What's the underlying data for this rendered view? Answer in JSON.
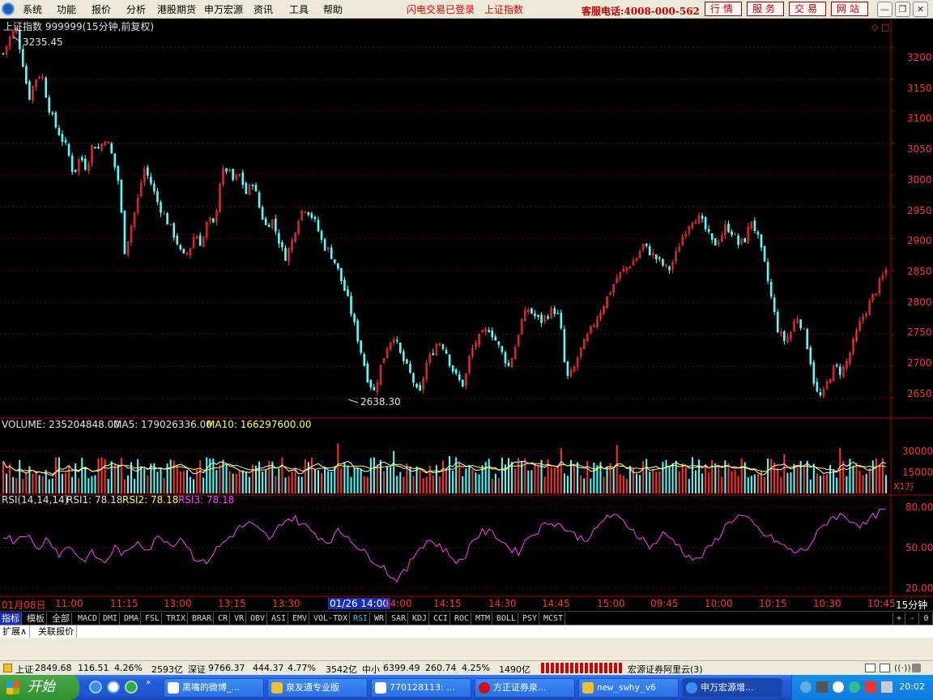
{
  "menu": {
    "items": [
      "系统",
      "功能",
      "报价",
      "分析",
      "港股期货",
      "申万宏源",
      "资讯",
      "工具",
      "帮助"
    ],
    "flash_login": "闪电交易已登录",
    "index_name": "上证指数",
    "service_phone": "客服电话:4008-000-562",
    "tabs": [
      "行情",
      "服务",
      "交易",
      "网站"
    ]
  },
  "chart_header": {
    "title": "上证指数 999999(15分钟,前复权)",
    "high_label": "3235.45",
    "low_label": "2638.30"
  },
  "price_axis": [
    "3200",
    "3150",
    "3100",
    "3050",
    "3000",
    "2950",
    "2900",
    "2850",
    "2800",
    "2750",
    "2700",
    "2650"
  ],
  "volume": {
    "label": "VOLUME: 235204848.00",
    "ma5": "MA5: 179026336.00",
    "ma10": "MA10: 166297600.00",
    "ticks": [
      "30000",
      "15000"
    ],
    "unit": "X1万"
  },
  "rsi": {
    "label": "RSI(14,14,14)",
    "rsi1": "RSI1: 78.18",
    "rsi2": "RSI2: 78.18",
    "rsi3": "RSI3: 78.18",
    "ticks": [
      "80.00",
      "50.00",
      "20.00"
    ]
  },
  "time_axis": [
    "01月08日",
    "11:00",
    "11:15",
    "13:00",
    "13:15",
    "13:30",
    "01/26 14:00",
    "14:00",
    "14:15",
    "14:30",
    "14:45",
    "15:00",
    "09:45",
    "10:00",
    "10:15",
    "10:30",
    "10:45",
    "15分钟"
  ],
  "indicator_tabs": [
    "指标",
    "模板",
    "全部",
    "MACD",
    "DMI",
    "DMA",
    "FSL",
    "TRIX",
    "BRAR",
    "CR",
    "VR",
    "OBV",
    "ASI",
    "EMV",
    "VOL-TDX",
    "RSI",
    "WR",
    "SAR",
    "KDJ",
    "CCI",
    "ROC",
    "MTM",
    "BOLL",
    "PSY",
    "MCST"
  ],
  "ext_tabs": [
    "扩展∧",
    "关联报价"
  ],
  "zoom_controls": [
    "+",
    "-",
    "0"
  ],
  "status": {
    "sh_name": "上证",
    "sh_value": "2849.68",
    "sh_change": "116.51",
    "sh_pct": "4.26%",
    "sh_amount": "2593亿",
    "sz_name": "深证",
    "sz_value": "9766.37",
    "sz_change": "444.37",
    "sz_pct": "4.77%",
    "sz_amount": "3542亿",
    "zx_name": "中小",
    "zx_value": "6399.49",
    "zx_change": "260.74",
    "zx_pct": "4.25%",
    "zx_amount": "1490亿",
    "broker": "宏源证券阿里云(3)"
  },
  "taskbar": {
    "start": "开始",
    "tasks": [
      "黑嘴的微博_...",
      "泉友通专业版",
      "770128113: ...",
      "方正证券泉...",
      "new_swhy_v6",
      "申万宏源增..."
    ],
    "clock": "20:02"
  },
  "chart_data": {
    "type": "candlestick",
    "price_range": [
      2620,
      3245
    ],
    "high": 3235.45,
    "low": 2638.3,
    "close_series": [
      3190,
      3215,
      3230,
      3180,
      3120,
      3150,
      3160,
      3110,
      3080,
      3060,
      3040,
      3000,
      3030,
      3010,
      3050,
      3040,
      3060,
      3030,
      2990,
      2880,
      2920,
      2960,
      3010,
      2990,
      2960,
      2940,
      2920,
      2900,
      2870,
      2880,
      2910,
      2890,
      2930,
      2920,
      3000,
      3010,
      2990,
      3000,
      2970,
      2990,
      2950,
      2920,
      2930,
      2900,
      2870,
      2890,
      2930,
      2950,
      2940,
      2920,
      2890,
      2880,
      2860,
      2830,
      2800,
      2760,
      2720,
      2680,
      2660,
      2700,
      2730,
      2750,
      2720,
      2700,
      2680,
      2650,
      2700,
      2720,
      2740,
      2730,
      2700,
      2680,
      2670,
      2720,
      2740,
      2750,
      2760,
      2740,
      2720,
      2700,
      2730,
      2770,
      2790,
      2780,
      2770,
      2780,
      2790,
      2775,
      2680,
      2690,
      2720,
      2740,
      2760,
      2780,
      2800,
      2820,
      2840,
      2850,
      2860,
      2870,
      2890,
      2880,
      2870,
      2860,
      2850,
      2870,
      2900,
      2920,
      2935,
      2930,
      2910,
      2890,
      2900,
      2920,
      2910,
      2890,
      2900,
      2930,
      2900,
      2860,
      2810,
      2760,
      2740,
      2750,
      2780,
      2760,
      2720,
      2660,
      2650,
      2680,
      2700,
      2690,
      2710,
      2740,
      2770,
      2790,
      2810,
      2830,
      2850
    ],
    "rsi_series": [
      60,
      55,
      62,
      48,
      58,
      45,
      52,
      40,
      46,
      38,
      50,
      44,
      56,
      48,
      60,
      52,
      58,
      44,
      38,
      48,
      56,
      64,
      68,
      62,
      56,
      70,
      72,
      66,
      60,
      54,
      62,
      58,
      48,
      42,
      36,
      26,
      32,
      48,
      56,
      52,
      44,
      38,
      56,
      62,
      60,
      52,
      46,
      58,
      64,
      70,
      66,
      60,
      56,
      62,
      74,
      72,
      66,
      58,
      50,
      60,
      56,
      46,
      40,
      48,
      58,
      70,
      74,
      68,
      60,
      56,
      50,
      46,
      50,
      62,
      72,
      74,
      70,
      66,
      74,
      78
    ],
    "vol_ticks": [
      30000,
      15000
    ],
    "rsi_ticks": [
      80,
      50,
      20
    ]
  }
}
